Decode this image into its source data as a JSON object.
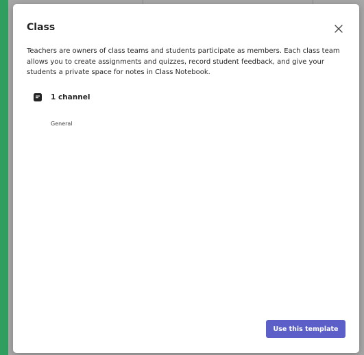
{
  "dialog": {
    "title": "Class",
    "description": "Teachers are owners of class teams and students participate as members. Each class team allows you to create assignments and quizzes, record student feedback, and give your students a private space for notes in Class Notebook.",
    "channel_count_label": "1 channel",
    "channels": [
      "General"
    ],
    "primary_button_label": "Use this template"
  },
  "colors": {
    "accent": "#5b5fc7",
    "text": "#242424",
    "overlay": "#a7a7a7",
    "edge_green": "#2f9e5e"
  },
  "icons": {
    "close": "close-icon",
    "channel": "channel-icon"
  }
}
